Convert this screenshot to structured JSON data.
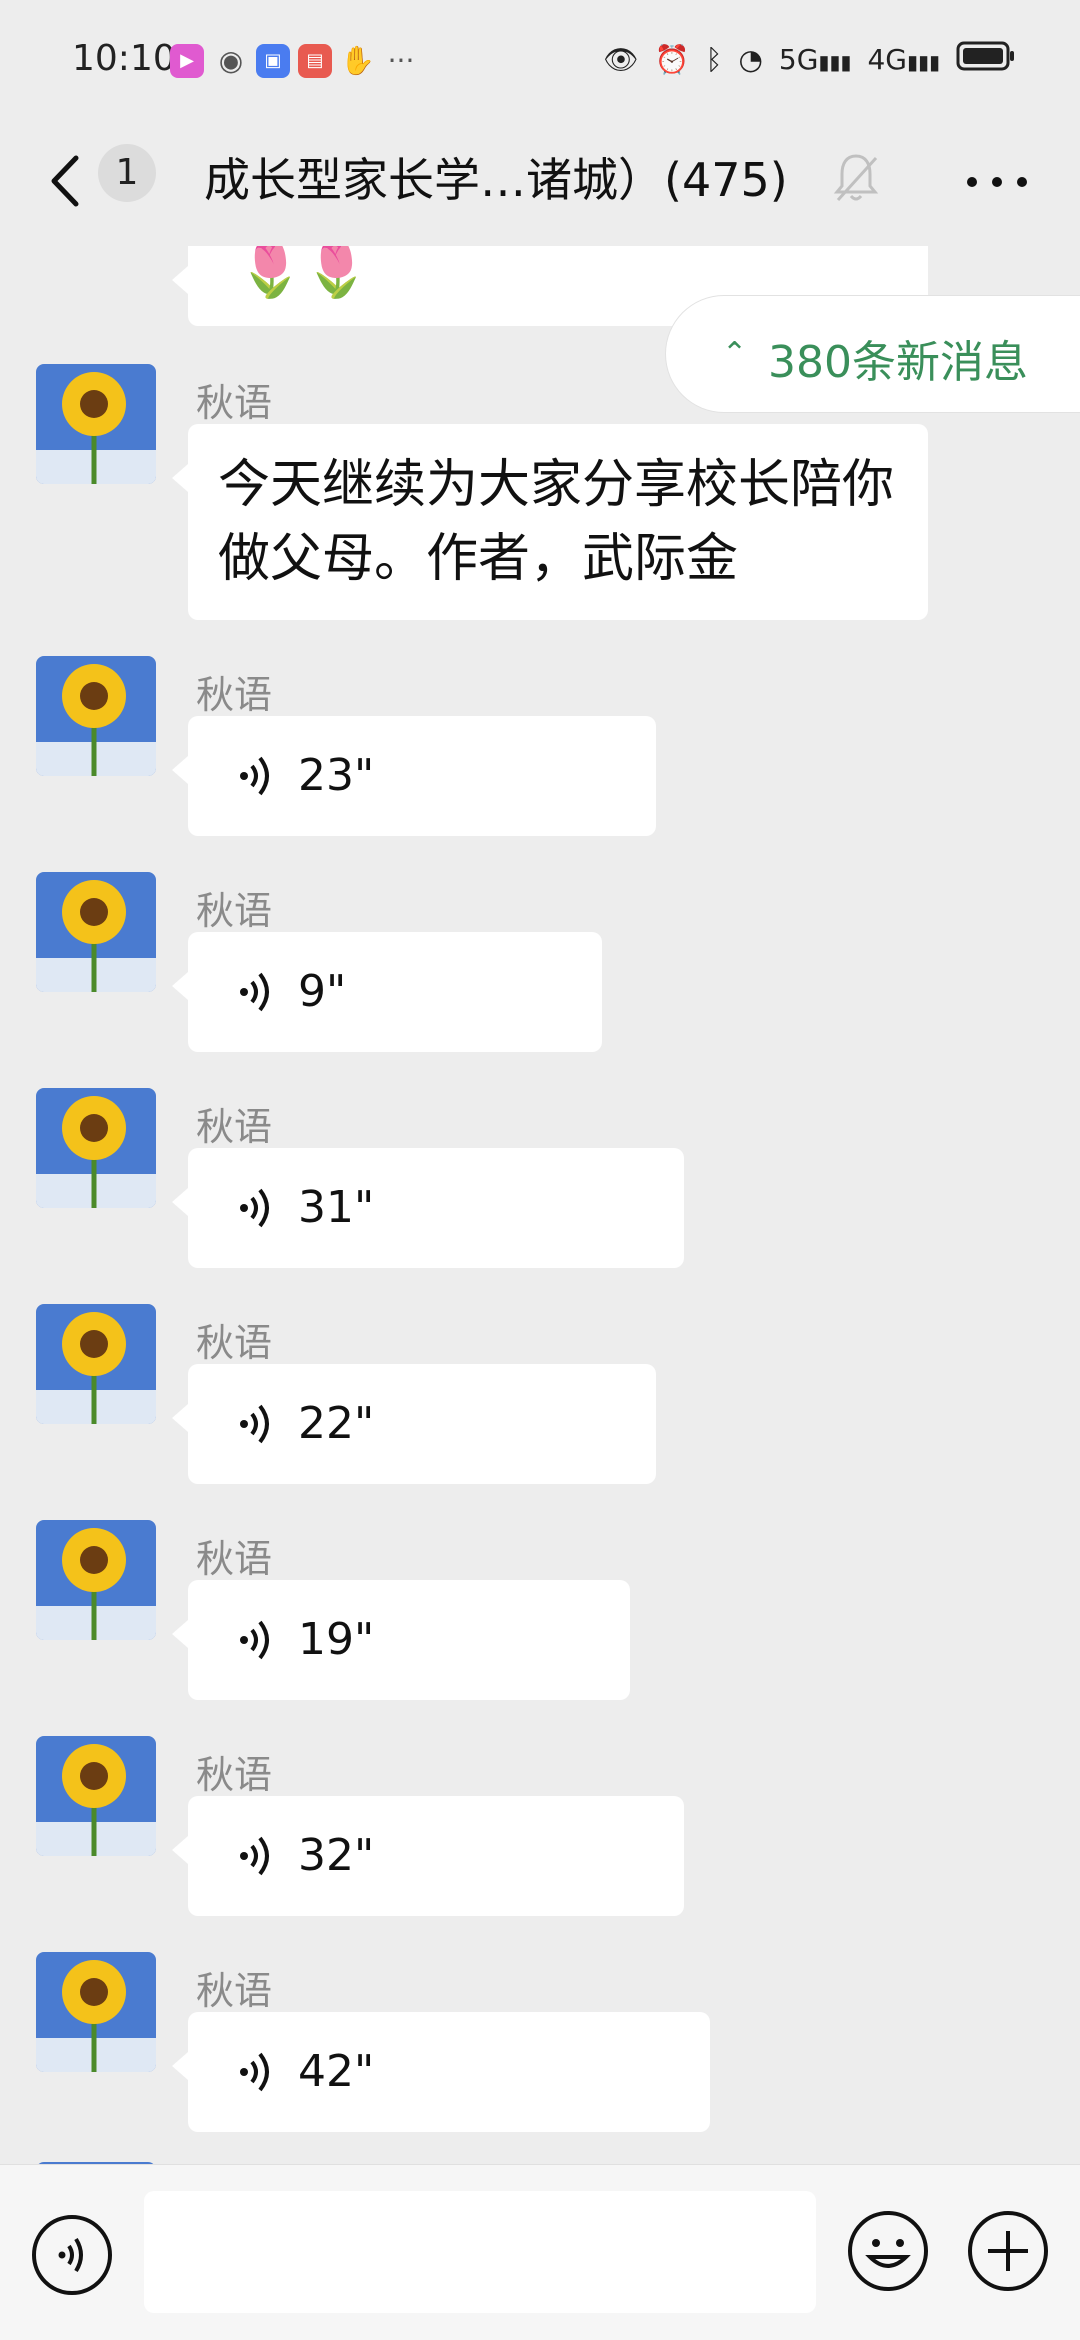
{
  "status_bar": {
    "time": "10:10",
    "icons": [
      "video-app-icon",
      "wechat-icon",
      "store-icon",
      "huawei-icon",
      "hand-icon",
      "more-dots"
    ],
    "right_icons": [
      "eye-icon",
      "alarm-icon",
      "bluetooth-icon",
      "wifi-icon",
      "5g-signal-icon",
      "4g-signal-icon",
      "battery-icon"
    ],
    "signal_5g": "5G",
    "signal_4g": "4G"
  },
  "nav": {
    "unread_count": "1",
    "title": "成长型家长学…诸城）(475)"
  },
  "new_messages": {
    "label": "380条新消息"
  },
  "messages": [
    {
      "sender": "秋语",
      "type": "text",
      "text": "今天继续为大家分享校长陪你做父母。作者，武际金"
    },
    {
      "sender": "秋语",
      "type": "voice",
      "duration": "23\""
    },
    {
      "sender": "秋语",
      "type": "voice",
      "duration": "9\""
    },
    {
      "sender": "秋语",
      "type": "voice",
      "duration": "31\""
    },
    {
      "sender": "秋语",
      "type": "voice",
      "duration": "22\""
    },
    {
      "sender": "秋语",
      "type": "voice",
      "duration": "19\""
    },
    {
      "sender": "秋语",
      "type": "voice",
      "duration": "32\""
    },
    {
      "sender": "秋语",
      "type": "voice",
      "duration": "42\""
    }
  ],
  "colors": {
    "background": "#ededed",
    "bubble": "#ffffff",
    "accent_green": "#3a8f5a",
    "sender_gray": "#8a8a8a"
  }
}
